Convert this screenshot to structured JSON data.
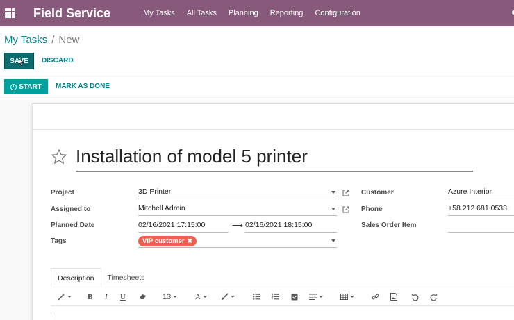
{
  "topbar": {
    "brand": "Field Service",
    "nav": [
      "My Tasks",
      "All Tasks",
      "Planning",
      "Reporting",
      "Configuration"
    ],
    "background": "#875a7b"
  },
  "breadcrumb": {
    "parent": "My Tasks",
    "separator": "/",
    "current": "New"
  },
  "buttons": {
    "save": "SAVE",
    "discard": "DISCARD",
    "start": "START",
    "mark_as_done": "MARK AS DONE"
  },
  "form": {
    "title": "Installation of model 5 printer",
    "project_label": "Project",
    "project_value": "3D Printer",
    "assigned_label": "Assigned to",
    "assigned_value": "Mitchell Admin",
    "planned_label": "Planned Date",
    "planned_start": "02/16/2021 17:15:00",
    "planned_arrow": "⟶",
    "planned_end": "02/16/2021 18:15:00",
    "tags_label": "Tags",
    "tag": "VIP customer",
    "customer_label": "Customer",
    "customer_value": "Azure Interior",
    "phone_label": "Phone",
    "phone_value": "+58 212 681 0538",
    "sales_order_label": "Sales Order Item"
  },
  "tabs": [
    "Description",
    "Timesheets"
  ],
  "editor": {
    "font_size": "13"
  },
  "colors": {
    "accent": "#00a09d",
    "link": "#00818b",
    "tag": "#f06050"
  }
}
